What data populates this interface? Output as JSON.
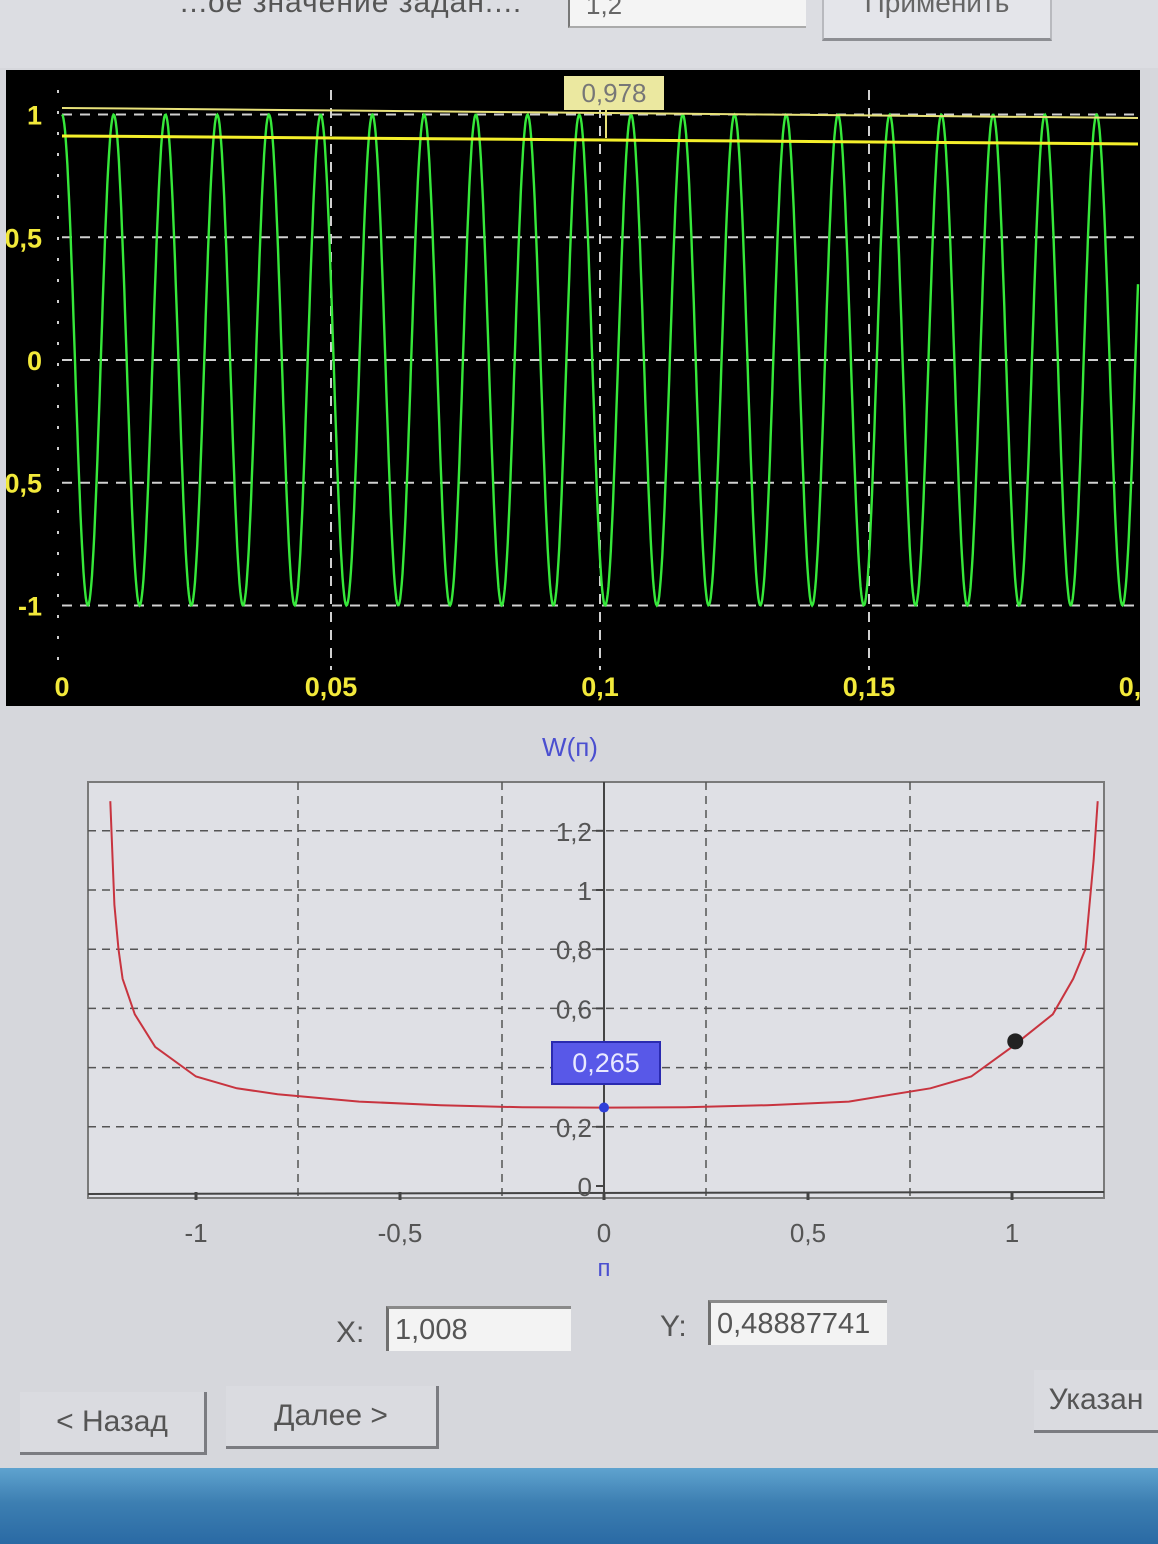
{
  "top": {
    "label": "...ое значение задан...:",
    "input_value": "1,2",
    "apply_button": "Применить"
  },
  "scope": {
    "cursor_value": "0,978",
    "y_ticks": [
      "1",
      "0,5",
      "0",
      "0,5",
      "-1"
    ],
    "x_ticks": [
      "0",
      "0,05",
      "0,1",
      "0,15",
      "0,"
    ],
    "colors": {
      "background": "#000000",
      "signal": "#36e83a",
      "level_line": "#f4ef2b",
      "grid": "#d0d0d0"
    }
  },
  "chart_data": [
    {
      "type": "line",
      "series": [
        {
          "values_description": "sinusoid amplitude ~1, 20 periods over 0..0.2"
        }
      ],
      "x_ticks": [
        "0",
        "0,05",
        "0,1",
        "0,15",
        "0,"
      ],
      "y_ticks": [
        "1",
        "0,5",
        "0",
        "0,5",
        "-1"
      ],
      "xlim": [
        0,
        0.2
      ],
      "ylim": [
        -1.1,
        1.1
      ],
      "horizontal_lines": [
        0.978
      ],
      "grid": true
    },
    {
      "type": "line",
      "title": "W(п)",
      "xlabel": "п",
      "ylabel": "",
      "x_ticks": [
        "-1",
        "-0,5",
        "0",
        "0,5",
        "1"
      ],
      "y_ticks": [
        "0",
        "0,2",
        "0,4",
        "0,6",
        "0,8",
        "1",
        "1,2"
      ],
      "xlim": [
        -1.25,
        1.25
      ],
      "ylim": [
        0,
        1.35
      ],
      "grid": true,
      "cursor_label": "0,265",
      "cursor_point": {
        "x": 0,
        "y": 0.265
      },
      "marker_point": {
        "x": 1.008,
        "y": 0.4888
      },
      "series": [
        {
          "x": [
            -1.21,
            -1.2,
            -1.19,
            -1.18,
            -1.15,
            -1.1,
            -1.0,
            -0.9,
            -0.8,
            -0.6,
            -0.4,
            -0.2,
            0,
            0.2,
            0.4,
            0.6,
            0.8,
            0.9,
            1.0,
            1.1,
            1.15,
            1.18,
            1.19,
            1.2,
            1.21
          ],
          "y": [
            1.3,
            0.95,
            0.8,
            0.7,
            0.58,
            0.47,
            0.37,
            0.33,
            0.31,
            0.285,
            0.273,
            0.266,
            0.265,
            0.266,
            0.273,
            0.285,
            0.33,
            0.37,
            0.47,
            0.58,
            0.7,
            0.8,
            0.95,
            1.1,
            1.3
          ]
        }
      ],
      "color": "#c8343f"
    }
  ],
  "readout": {
    "x_label": "X:",
    "x_value": "1,008",
    "y_label": "Y:",
    "y_value": "0,48887741"
  },
  "nav": {
    "back": "< Назад",
    "next": "Далее >",
    "right": "Указан"
  }
}
